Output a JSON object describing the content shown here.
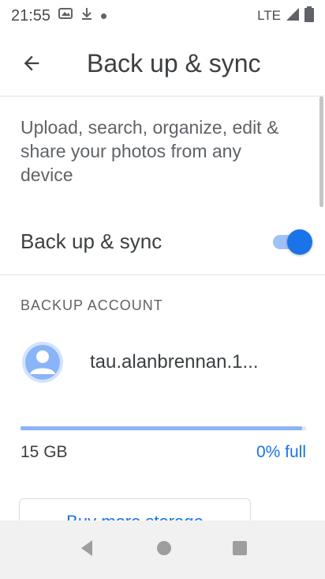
{
  "status_bar": {
    "time": "21:55",
    "network": "LTE"
  },
  "header": {
    "title": "Back up & sync"
  },
  "description": "Upload, search, organize, edit & share your photos from any device",
  "sync": {
    "label": "Back up & sync",
    "enabled": true
  },
  "backup_account": {
    "section_title": "BACKUP ACCOUNT",
    "account_name": "tau.alanbrennan.1..."
  },
  "storage": {
    "total": "15 GB",
    "used_label": "0% full",
    "used_fraction": 0.0
  },
  "buy_button": {
    "label": "Buy more storage"
  },
  "colors": {
    "accent": "#1a73e8",
    "nav_background": "#f1f1f1"
  }
}
